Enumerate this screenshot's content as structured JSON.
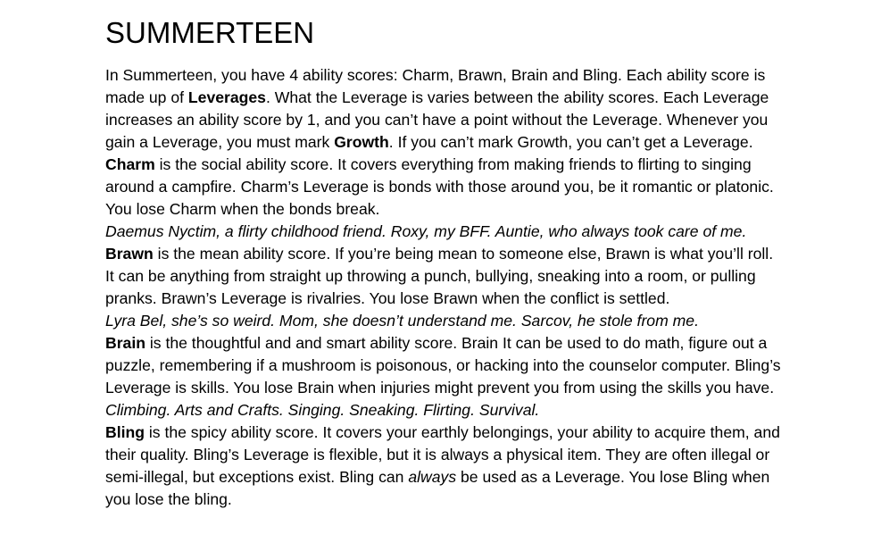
{
  "document": {
    "title": "SUMMERTEEN",
    "intro": {
      "t1": "In Summerteen, you have 4 ability scores: Charm, Brawn, Brain and Bling. Each ability score is made up of ",
      "b1": "Leverages",
      "t2": ". What the Leverage is varies between the ability scores. Each Leverage increases an ability score by 1, and you can’t have a point without the Leverage. Whenever you gain a Leverage, you must mark ",
      "b2": "Growth",
      "t3": ". If you can’t mark Growth, you can’t get a Leverage."
    },
    "charm": {
      "term": "Charm",
      "text": " is the social ability score. It covers everything from making friends to flirting to singing around a campfire. Charm’s Leverage is bonds with those around you, be it romantic or platonic. You lose Charm when the bonds break.",
      "examples": "Daemus Nyctim, a flirty childhood friend. Roxy, my BFF. Auntie, who always took care of me."
    },
    "brawn": {
      "term": "Brawn",
      "text": " is the mean ability score. If you’re being mean to someone else, Brawn is what you’ll roll. It can be anything from straight up throwing a punch, bullying, sneaking into a room, or pulling pranks. Brawn’s Leverage is rivalries. You lose Brawn when the conflict is settled.",
      "examples": "Lyra Bel, she’s so weird. Mom, she doesn’t understand me. Sarcov, he stole from me."
    },
    "brain": {
      "term": "Brain",
      "text": " is the thoughtful and and smart ability score. Brain It can be used to do math, figure out a puzzle, remembering if a mushroom is poisonous, or hacking into the counselor computer. Bling’s Leverage is skills. You lose Brain when injuries might prevent you from using the skills you have.",
      "examples": "Climbing. Arts and Crafts. Singing. Sneaking. Flirting. Survival."
    },
    "bling": {
      "term": "Bling",
      "text1": " is the spicy ability score. It covers your earthly belongings, your ability to acquire them, and their quality. Bling’s Leverage is flexible, but it is always a physical item. They are often illegal or semi-illegal, but exceptions exist. Bling can ",
      "emph": "always",
      "text2": " be used as a Leverage. You lose Bling when you lose the bling."
    }
  }
}
